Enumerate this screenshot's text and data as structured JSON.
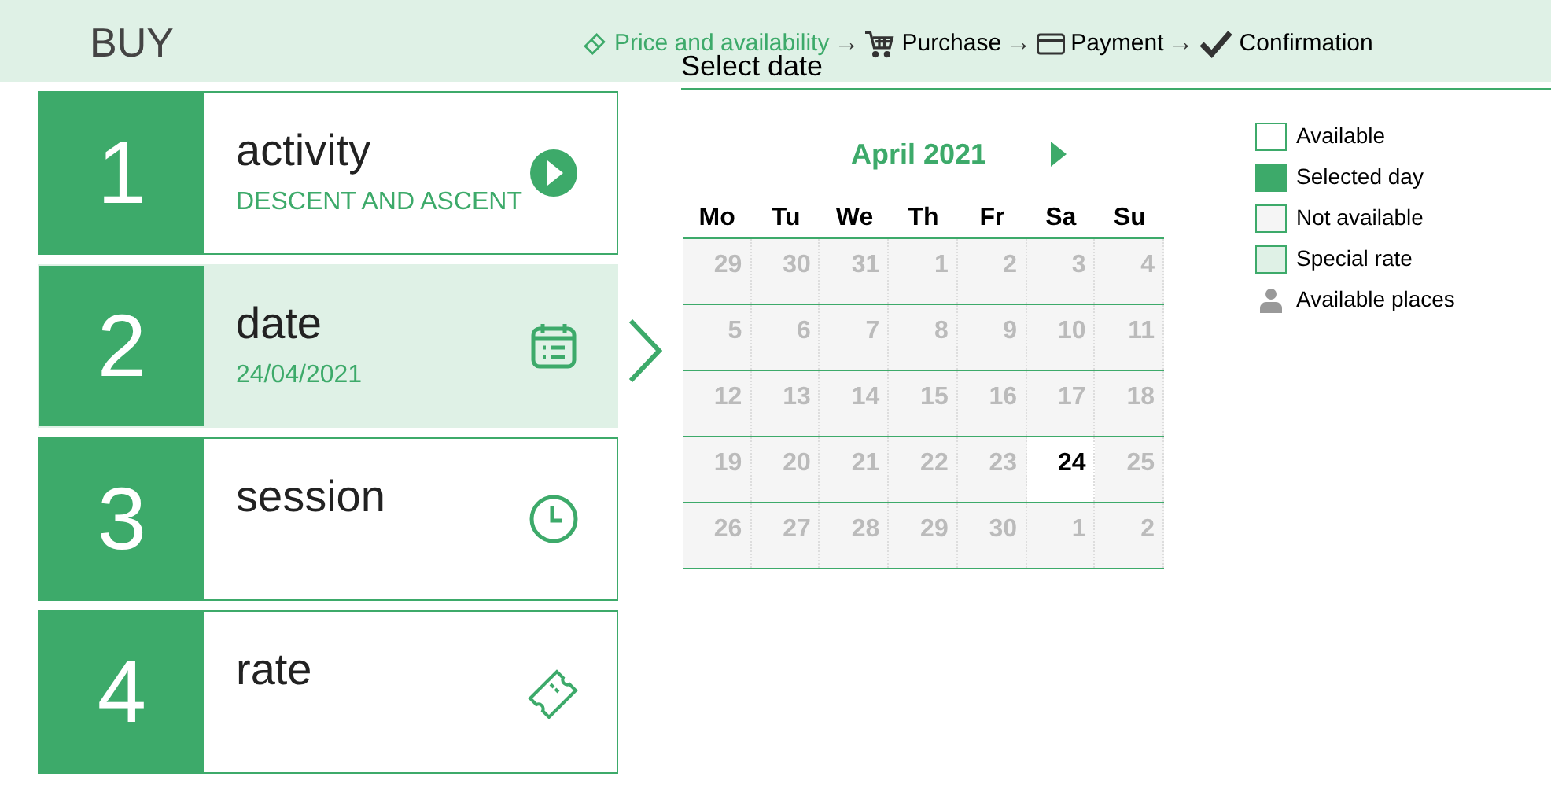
{
  "header": {
    "title": "BUY",
    "steps": [
      {
        "label": "Price and availability",
        "selected": true,
        "arrow": "→"
      },
      {
        "label": "Purchase",
        "selected": false,
        "arrow": "→"
      },
      {
        "label": "Payment",
        "selected": false,
        "arrow": "→"
      },
      {
        "label": "Confirmation",
        "selected": false
      }
    ]
  },
  "steps": [
    {
      "number": "1",
      "title": "activity",
      "value": "DESCENT AND ASCENT",
      "selected": false
    },
    {
      "number": "2",
      "title": "date",
      "value": "24/04/2021",
      "selected": true
    },
    {
      "number": "3",
      "title": "session",
      "selected": false
    },
    {
      "number": "4",
      "title": "rate",
      "selected": false
    }
  ],
  "calendar": {
    "heading": "Select date",
    "month": "April 2021",
    "weekdays": [
      "Mo",
      "Tu",
      "We",
      "Th",
      "Fr",
      "Sa",
      "Su"
    ],
    "weeks": [
      [
        {
          "day": "29",
          "available": false
        },
        {
          "day": "30",
          "available": false
        },
        {
          "day": "31",
          "available": false
        },
        {
          "day": "1",
          "available": false
        },
        {
          "day": "2",
          "available": false
        },
        {
          "day": "3",
          "available": false
        },
        {
          "day": "4",
          "available": false
        }
      ],
      [
        {
          "day": "5",
          "available": false
        },
        {
          "day": "6",
          "available": false
        },
        {
          "day": "7",
          "available": false
        },
        {
          "day": "8",
          "available": false
        },
        {
          "day": "9",
          "available": false
        },
        {
          "day": "10",
          "available": false
        },
        {
          "day": "11",
          "available": false
        }
      ],
      [
        {
          "day": "12",
          "available": false
        },
        {
          "day": "13",
          "available": false
        },
        {
          "day": "14",
          "available": false
        },
        {
          "day": "15",
          "available": false
        },
        {
          "day": "16",
          "available": false
        },
        {
          "day": "17",
          "available": false
        },
        {
          "day": "18",
          "available": false
        }
      ],
      [
        {
          "day": "19",
          "available": false
        },
        {
          "day": "20",
          "available": false
        },
        {
          "day": "21",
          "available": false
        },
        {
          "day": "22",
          "available": false
        },
        {
          "day": "23",
          "available": false
        },
        {
          "day": "24",
          "available": true
        },
        {
          "day": "25",
          "available": false
        }
      ],
      [
        {
          "day": "26",
          "available": false
        },
        {
          "day": "27",
          "available": false
        },
        {
          "day": "28",
          "available": false
        },
        {
          "day": "29",
          "available": false
        },
        {
          "day": "30",
          "available": false
        },
        {
          "day": "1",
          "available": false
        },
        {
          "day": "2",
          "available": false
        }
      ]
    ]
  },
  "legend": [
    {
      "kind": "available",
      "label": "Available"
    },
    {
      "kind": "selected",
      "label": "Selected day"
    },
    {
      "kind": "unavailable",
      "label": "Not available"
    },
    {
      "kind": "special",
      "label": "Special rate"
    },
    {
      "kind": "places",
      "label": "Available places"
    }
  ]
}
